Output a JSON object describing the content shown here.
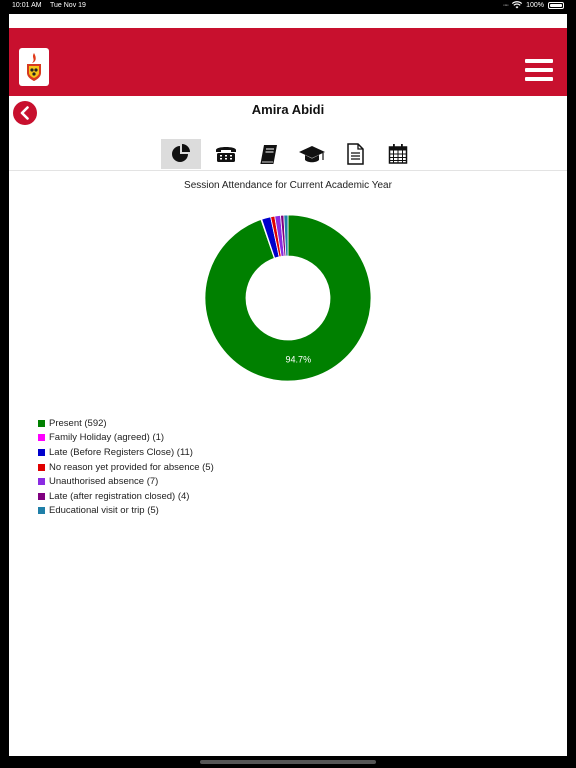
{
  "status_bar": {
    "time": "10:01 AM",
    "date": "Tue Nov 19",
    "battery": "100%"
  },
  "header": {
    "student_name": "Amira Abidi"
  },
  "tabs": [
    {
      "icon": "pie-chart-icon",
      "active": true
    },
    {
      "icon": "telephone-icon",
      "active": false
    },
    {
      "icon": "book-icon",
      "active": false
    },
    {
      "icon": "graduation-cap-icon",
      "active": false
    },
    {
      "icon": "document-icon",
      "active": false
    },
    {
      "icon": "calendar-icon",
      "active": false
    }
  ],
  "chart_data": {
    "type": "pie",
    "title": "Session Attendance for Current Academic Year",
    "slice_label": "94.7%",
    "series": [
      {
        "name": "Present",
        "value": 592,
        "label": "Present (592)",
        "color": "#008000"
      },
      {
        "name": "Family Holiday (agreed)",
        "value": 1,
        "label": "Family Holiday (agreed) (1)",
        "color": "#ff00ff"
      },
      {
        "name": "Late (Before Registers Close)",
        "value": 11,
        "label": "Late (Before Registers Close) (11)",
        "color": "#0000cc"
      },
      {
        "name": "No reason yet provided for absence",
        "value": 5,
        "label": "No reason yet provided for absence (5)",
        "color": "#e00000"
      },
      {
        "name": "Unauthorised absence",
        "value": 7,
        "label": "Unauthorised absence (7)",
        "color": "#8a2be2"
      },
      {
        "name": "Late (after registration closed)",
        "value": 4,
        "label": "Late (after registration closed) (4)",
        "color": "#800080"
      },
      {
        "name": "Educational visit or trip",
        "value": 5,
        "label": "Educational visit or trip (5)",
        "color": "#1f7fa8"
      }
    ]
  }
}
